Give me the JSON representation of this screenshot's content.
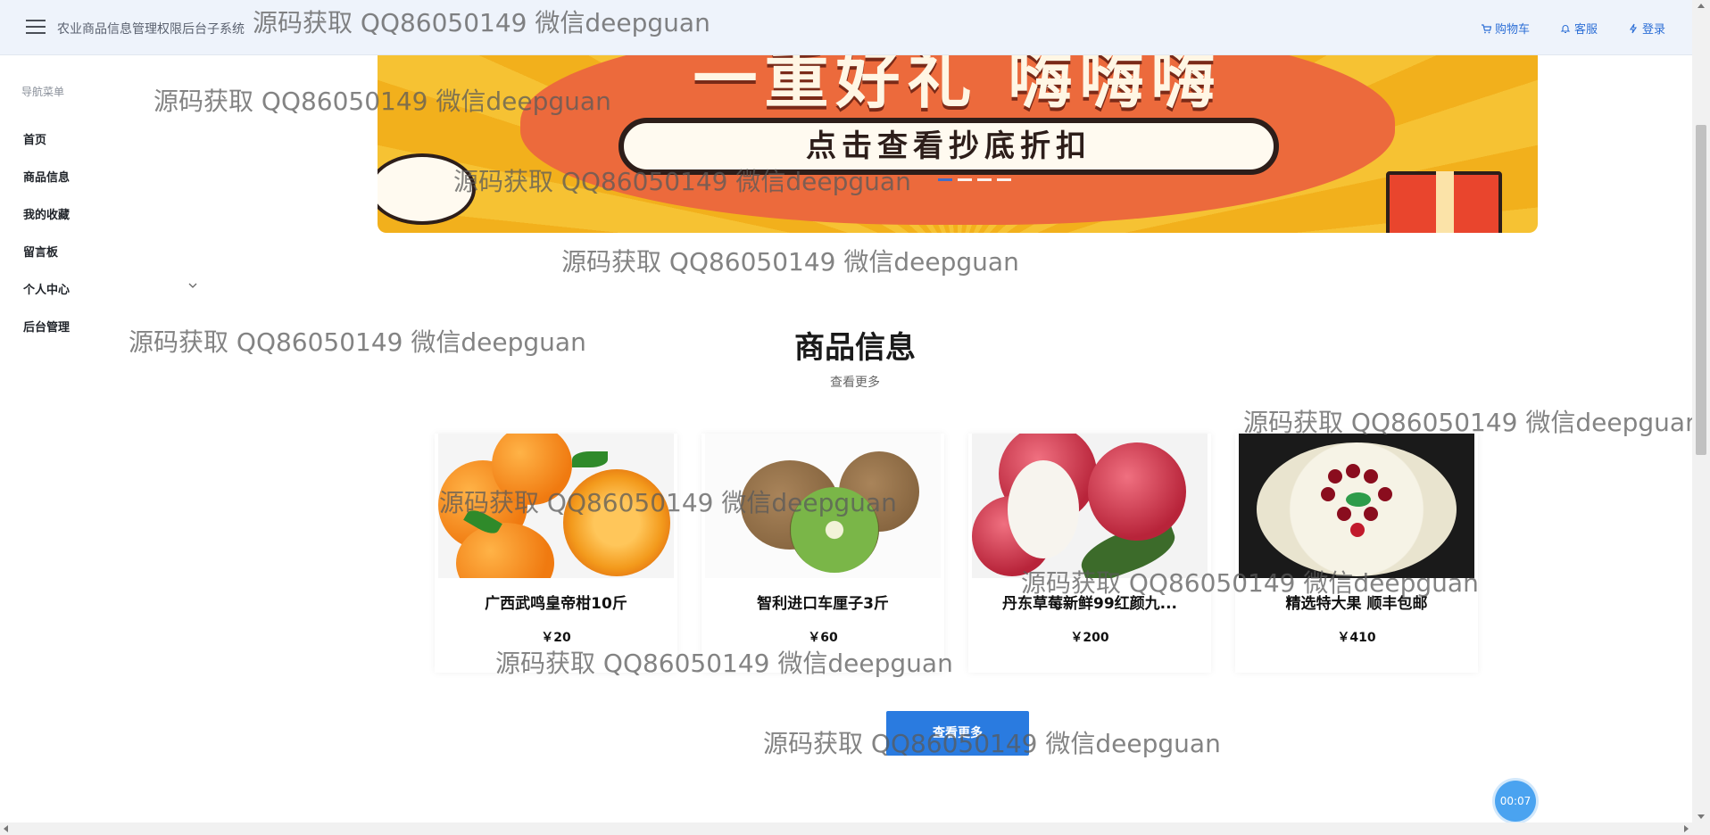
{
  "header": {
    "app_title": "农业商品信息管理权限后台子系统",
    "actions": [
      {
        "label": "购物车",
        "icon": "cart-icon"
      },
      {
        "label": "客服",
        "icon": "bell-icon"
      },
      {
        "label": "登录",
        "icon": "lightning-icon"
      }
    ]
  },
  "sidebar": {
    "header": "导航菜单",
    "items": [
      {
        "label": "首页"
      },
      {
        "label": "商品信息"
      },
      {
        "label": "我的收藏"
      },
      {
        "label": "留言板"
      },
      {
        "label": "个人中心",
        "has_submenu": true
      },
      {
        "label": "后台管理"
      }
    ]
  },
  "banner": {
    "heading": "一重好礼 嗨嗨嗨",
    "pill_text": "点击查看抄底折扣",
    "active_slide": 1,
    "slide_count": 4
  },
  "section": {
    "title": "商品信息",
    "more_link": "查看更多",
    "more_button": "查看更多"
  },
  "products": [
    {
      "name": "广西武鸣皇帝柑10斤",
      "price": "￥20",
      "image": "oranges"
    },
    {
      "name": "智利进口车厘子3斤",
      "price": "￥60",
      "image": "kiwi"
    },
    {
      "name": "丹东草莓新鲜99红颜九...",
      "price": "￥200",
      "image": "lychee"
    },
    {
      "name": "精选特大果 顺丰包邮",
      "price": "￥410",
      "image": "fruit-platter"
    }
  ],
  "timer": "00:07",
  "watermark": "源码获取 QQ86050149 微信deepguan",
  "colors": {
    "accent": "#2a7be0",
    "topbar_bg": "#eef3fb",
    "link": "#2d6fd6"
  }
}
